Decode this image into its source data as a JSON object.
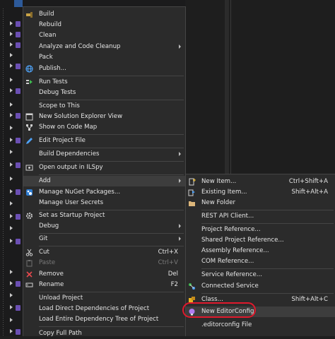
{
  "main_menu": {
    "items": [
      {
        "label": "Build",
        "icon": "build-icon"
      },
      {
        "label": "Rebuild"
      },
      {
        "label": "Clean"
      },
      {
        "label": "Analyze and Code Cleanup",
        "submenu": true
      },
      {
        "label": "Pack"
      },
      {
        "label": "Publish...",
        "icon": "globe-icon"
      },
      {
        "label": "Run Tests",
        "icon": "run-tests-icon"
      },
      {
        "label": "Debug Tests"
      },
      {
        "label": "Scope to This"
      },
      {
        "label": "New Solution Explorer View",
        "icon": "solution-explorer-icon"
      },
      {
        "label": "Show on Code Map",
        "icon": "code-map-icon"
      },
      {
        "label": "Edit Project File",
        "icon": "edit-project-icon"
      },
      {
        "label": "Build Dependencies",
        "submenu": true
      },
      {
        "label": "Open output in ILSpy",
        "icon": "ilspy-icon"
      },
      {
        "label": "Add",
        "submenu": true,
        "highlighted": true
      },
      {
        "label": "Manage NuGet Packages...",
        "icon": "nuget-icon"
      },
      {
        "label": "Manage User Secrets"
      },
      {
        "label": "Set as Startup Project",
        "icon": "gear-icon"
      },
      {
        "label": "Debug",
        "submenu": true
      },
      {
        "label": "Git",
        "submenu": true
      },
      {
        "label": "Cut",
        "shortcut": "Ctrl+X",
        "icon": "cut-icon"
      },
      {
        "label": "Paste",
        "shortcut": "Ctrl+V",
        "icon": "paste-icon",
        "disabled": true
      },
      {
        "label": "Remove",
        "shortcut": "Del",
        "icon": "remove-icon"
      },
      {
        "label": "Rename",
        "shortcut": "F2",
        "icon": "rename-icon"
      },
      {
        "label": "Unload Project"
      },
      {
        "label": "Load Direct Dependencies of Project"
      },
      {
        "label": "Load Entire Dependency Tree of Project"
      },
      {
        "label": "Copy Full Path"
      }
    ]
  },
  "add_submenu": {
    "items": [
      {
        "label": "New Item...",
        "shortcut": "Ctrl+Shift+A",
        "icon": "new-item-icon"
      },
      {
        "label": "Existing Item...",
        "shortcut": "Shift+Alt+A",
        "icon": "existing-item-icon"
      },
      {
        "label": "New Folder",
        "icon": "folder-icon"
      },
      {
        "label": "REST API Client..."
      },
      {
        "label": "Project Reference..."
      },
      {
        "label": "Shared Project Reference..."
      },
      {
        "label": "Assembly Reference..."
      },
      {
        "label": "COM Reference..."
      },
      {
        "label": "Service Reference..."
      },
      {
        "label": "Connected Service",
        "icon": "connected-service-icon"
      },
      {
        "label": "Class...",
        "shortcut": "Shift+Alt+C",
        "icon": "class-icon"
      },
      {
        "label": "New EditorConfig",
        "icon": "editorconfig-icon",
        "hover": true
      },
      {
        "label": ".editorconfig File"
      }
    ]
  },
  "colors": {
    "menu_bg": "#2b2b2b",
    "hover_bg": "#3d3d3d",
    "annotation": "#e0192c"
  }
}
